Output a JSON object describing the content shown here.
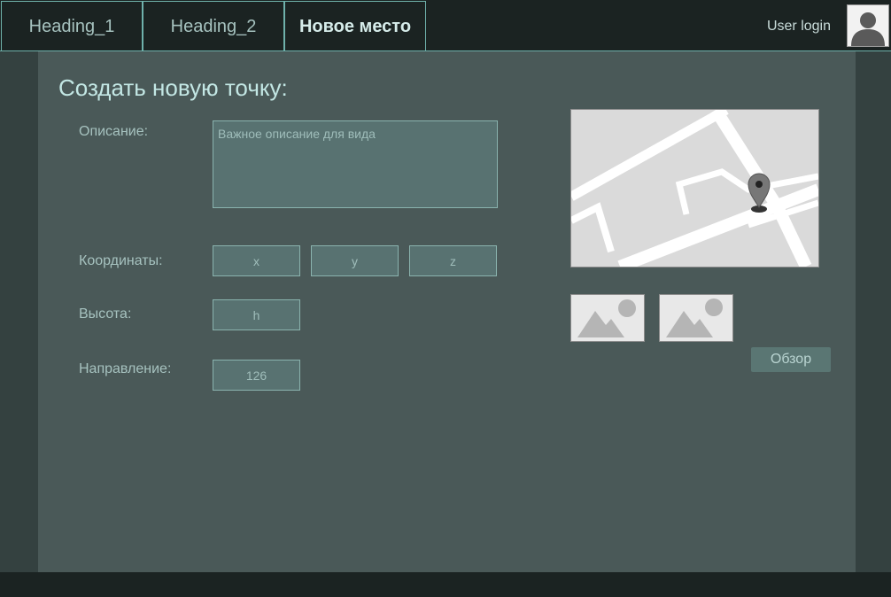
{
  "nav": {
    "tabs": [
      {
        "label": "Heading_1"
      },
      {
        "label": "Heading_2"
      },
      {
        "label": "Новое место"
      }
    ],
    "user_login": "User login"
  },
  "form": {
    "title": "Создать новую точку:",
    "description_label": "Описание:",
    "description_placeholder": "Важное описание для вида",
    "coords_label": "Координаты:",
    "x_placeholder": "x",
    "y_placeholder": "y",
    "z_placeholder": "z",
    "height_label": "Высота:",
    "height_placeholder": "h",
    "direction_label": "Направление:",
    "direction_value": "126"
  },
  "media": {
    "browse_label": "Обзор"
  },
  "colors": {
    "accent": "#6fb1ab",
    "topbar": "#1b2322",
    "panel": "#4a5958",
    "field_bg": "#587271"
  }
}
